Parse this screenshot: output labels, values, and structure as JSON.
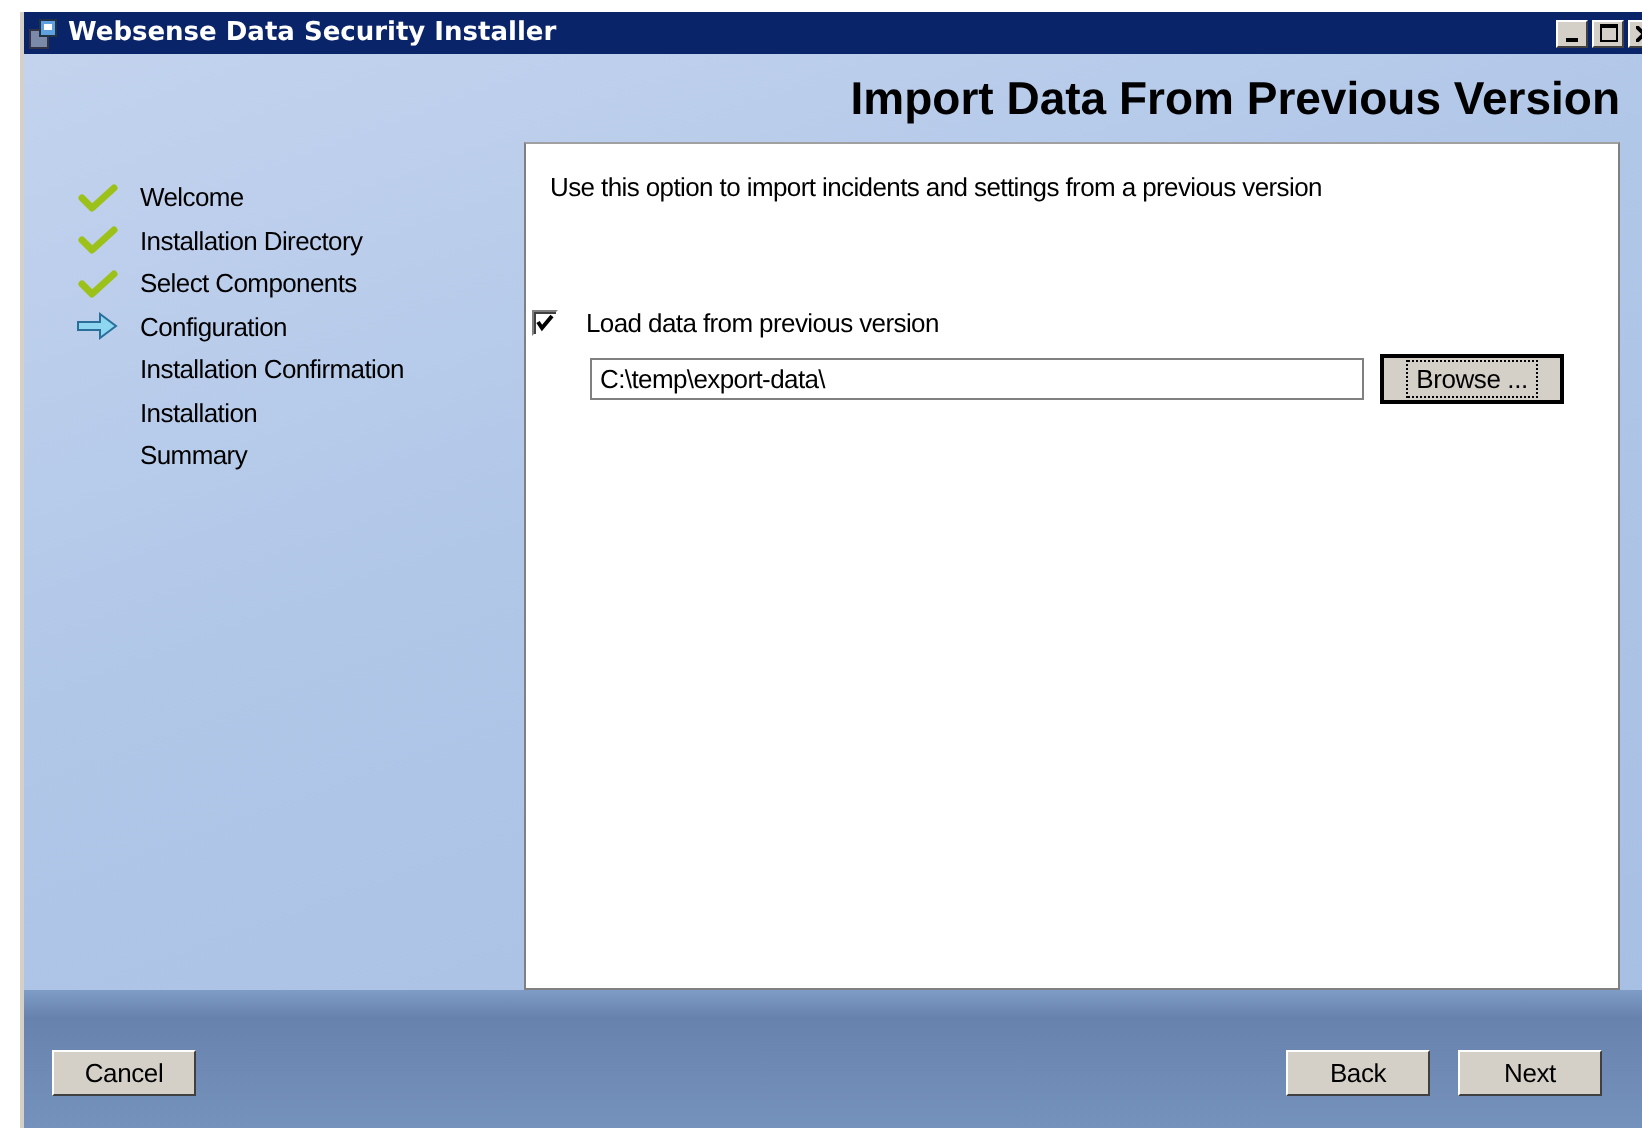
{
  "window": {
    "title": "Websense Data Security Installer"
  },
  "page_title": "Import Data From Previous Version",
  "steps": [
    {
      "label": "Welcome",
      "kind": "done"
    },
    {
      "label": "Installation Directory",
      "kind": "done"
    },
    {
      "label": "Select Components",
      "kind": "done"
    },
    {
      "label": "Configuration",
      "kind": "current"
    },
    {
      "label": "Installation Confirmation",
      "kind": "pending"
    },
    {
      "label": "Installation",
      "kind": "pending"
    },
    {
      "label": "Summary",
      "kind": "pending"
    }
  ],
  "description": "Use this option to import incidents and settings from a previous version",
  "load_option": {
    "label": "Load data from previous version",
    "checked": true
  },
  "path_field": {
    "value": "C:\\temp\\export-data\\"
  },
  "browse_button": "Browse ...",
  "buttons": {
    "cancel": "Cancel",
    "back": "Back",
    "next": "Next"
  }
}
